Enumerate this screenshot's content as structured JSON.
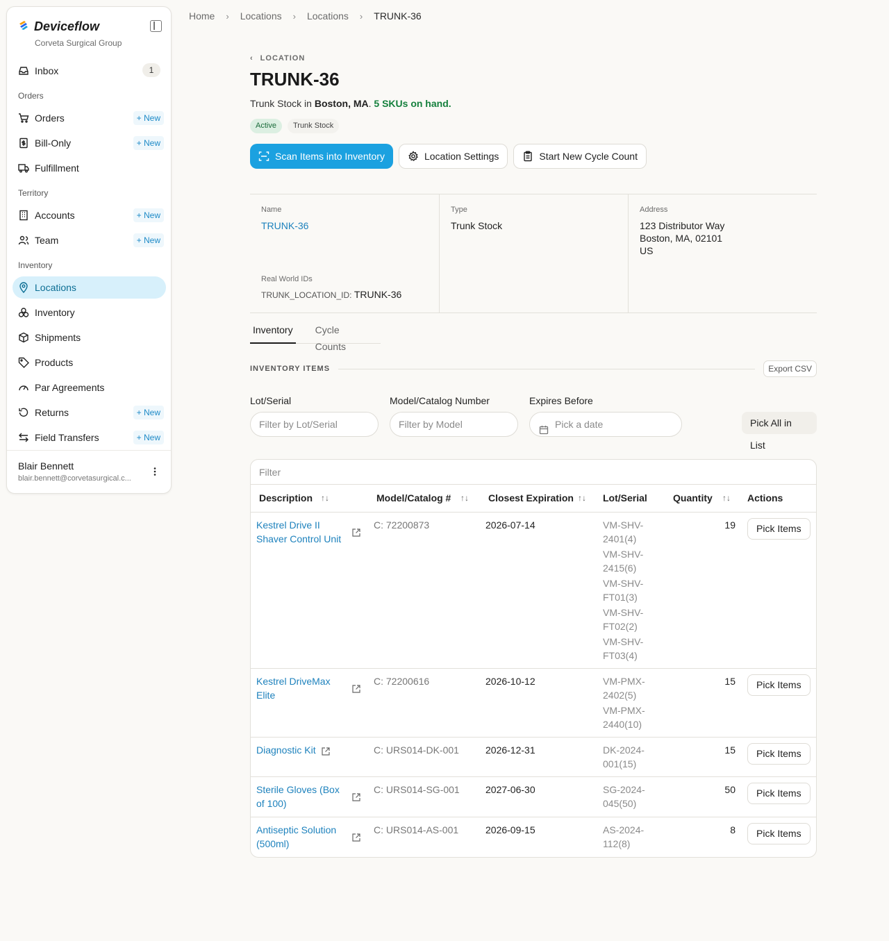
{
  "sidebar": {
    "brand": "Deviceflow",
    "org": "Corveta Surgical Group",
    "inbox": {
      "label": "Inbox",
      "count": "1"
    },
    "sections": {
      "orders": "Orders",
      "territory": "Territory",
      "inventory": "Inventory"
    },
    "new_label": "New",
    "items": [
      {
        "label": "Orders",
        "icon": "cart-icon"
      },
      {
        "label": "Bill-Only",
        "icon": "receipt-icon"
      },
      {
        "label": "Fulfillment",
        "icon": "truck-icon"
      },
      {
        "label": "Accounts",
        "icon": "building-icon"
      },
      {
        "label": "Team",
        "icon": "team-icon"
      },
      {
        "label": "Locations",
        "icon": "map-pin-icon"
      },
      {
        "label": "Inventory",
        "icon": "boxes-icon"
      },
      {
        "label": "Shipments",
        "icon": "package-icon"
      },
      {
        "label": "Products",
        "icon": "tag-icon"
      },
      {
        "label": "Par Agreements",
        "icon": "gauge-icon"
      },
      {
        "label": "Returns",
        "icon": "undo-icon"
      },
      {
        "label": "Field Transfers",
        "icon": "transfer-icon"
      }
    ],
    "user": {
      "name": "Blair Bennett",
      "email": "blair.bennett@corvetasurgical.c..."
    }
  },
  "breadcrumb": [
    "Home",
    "Locations",
    "Locations",
    "TRUNK-36"
  ],
  "page": {
    "back_label": "LOCATION",
    "title": "TRUNK-36",
    "summary": {
      "prefix": "Trunk Stock in ",
      "city": "Boston, MA",
      "mid": ". ",
      "skus": "5 SKUs on hand."
    },
    "pills": {
      "status": "Active",
      "type": "Trunk Stock"
    },
    "actions": {
      "scan": "Scan Items into Inventory",
      "settings": "Location Settings",
      "cycle": "Start New Cycle Count"
    }
  },
  "details": {
    "name_label": "Name",
    "name": "TRUNK-36",
    "type_label": "Type",
    "type": "Trunk Stock",
    "address_label": "Address",
    "address": [
      "123 Distributor Way",
      "Boston, MA, 02101",
      "US"
    ],
    "rw_label": "Real World IDs",
    "rw_key": "TRUNK_LOCATION_ID:",
    "rw_value": "TRUNK-36"
  },
  "tabs": [
    "Inventory",
    "Cycle Counts"
  ],
  "inventory": {
    "section_title": "INVENTORY ITEMS",
    "export": "Export CSV",
    "filters": {
      "lot_label": "Lot/Serial",
      "lot_placeholder": "Filter by Lot/Serial",
      "model_label": "Model/Catalog Number",
      "model_placeholder": "Filter by Model",
      "exp_label": "Expires Before",
      "exp_placeholder": "Pick a date",
      "pick_all": "Pick All in List"
    },
    "table_filter": "Filter",
    "columns": [
      "Description",
      "Model/Catalog #",
      "Closest Expiration",
      "Lot/Serial",
      "Quantity",
      "Actions"
    ],
    "action_label": "Pick Items",
    "rows": [
      {
        "desc": "Kestrel Drive II Shaver Control Unit",
        "model": "C: 72200873",
        "exp": "2026-07-14",
        "lots": [
          "VM-SHV-2401(4)",
          "VM-SHV-2415(6)",
          "VM-SHV-FT01(3)",
          "VM-SHV-FT02(2)",
          "VM-SHV-FT03(4)"
        ],
        "qty": "19"
      },
      {
        "desc": "Kestrel DriveMax Elite",
        "model": "C: 72200616",
        "exp": "2026-10-12",
        "lots": [
          "VM-PMX-2402(5)",
          "VM-PMX-2440(10)"
        ],
        "qty": "15"
      },
      {
        "desc": "Diagnostic Kit",
        "model": "C: URS014-DK-001",
        "exp": "2026-12-31",
        "lots": [
          "DK-2024-001(15)"
        ],
        "qty": "15"
      },
      {
        "desc": "Sterile Gloves (Box of 100)",
        "model": "C: URS014-SG-001",
        "exp": "2027-06-30",
        "lots": [
          "SG-2024-045(50)"
        ],
        "qty": "50"
      },
      {
        "desc": "Antiseptic Solution (500ml)",
        "model": "C: URS014-AS-001",
        "exp": "2026-09-15",
        "lots": [
          "AS-2024-112(8)"
        ],
        "qty": "8"
      }
    ]
  }
}
